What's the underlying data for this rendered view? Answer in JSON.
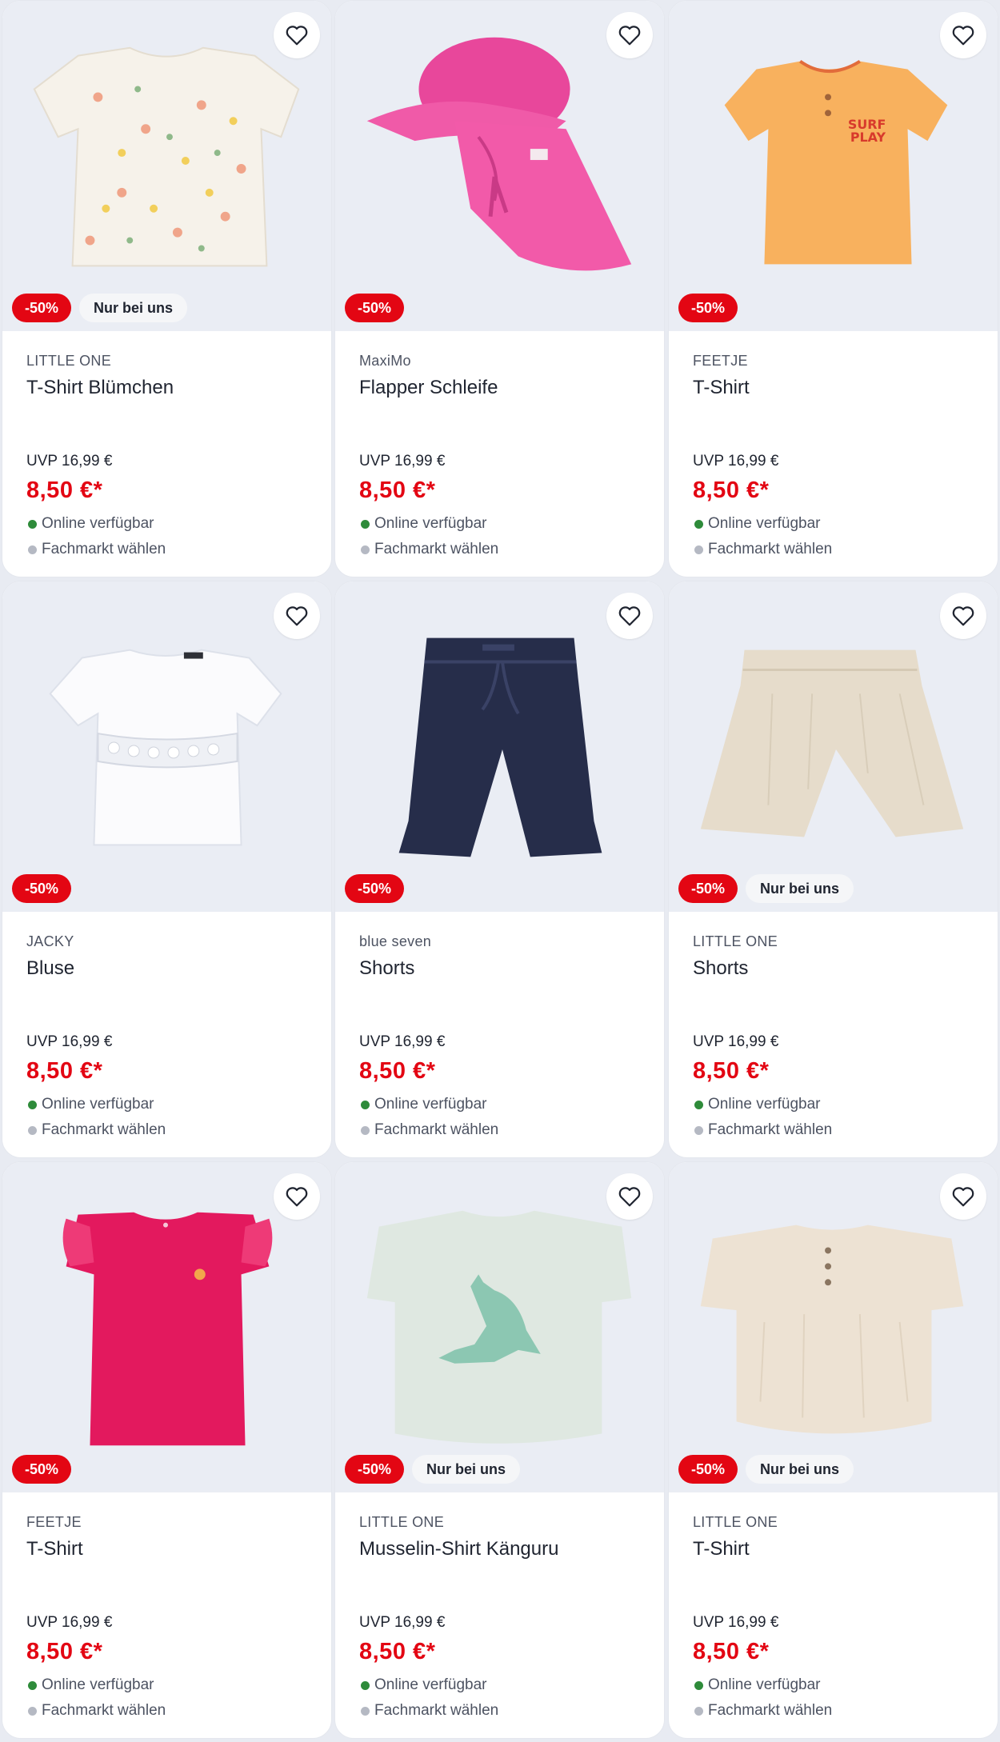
{
  "colors": {
    "sale": "#e30613",
    "available": "#2e8b3a",
    "store_dot": "#b5b9c3"
  },
  "products": [
    {
      "brand": "LITTLE ONE",
      "title": "T-Shirt Blümchen",
      "discount": "-50%",
      "exclusive": "Nur bei uns",
      "uvp": "UVP 16,99 €",
      "price": "8,50 €*",
      "availability": "Online verfügbar",
      "store": "Fachmarkt wählen",
      "image_icon": "floral-blouse"
    },
    {
      "brand": "MaxiMo",
      "title": "Flapper Schleife",
      "discount": "-50%",
      "exclusive": "",
      "uvp": "UVP 16,99 €",
      "price": "8,50 €*",
      "availability": "Online verfügbar",
      "store": "Fachmarkt wählen",
      "image_icon": "pink-sun-hat"
    },
    {
      "brand": "FEETJE",
      "title": "T-Shirt",
      "discount": "-50%",
      "exclusive": "",
      "uvp": "UVP 16,99 €",
      "price": "8,50 €*",
      "availability": "Online verfügbar",
      "store": "Fachmarkt wählen",
      "image_icon": "orange-tshirt"
    },
    {
      "brand": "JACKY",
      "title": "Bluse",
      "discount": "-50%",
      "exclusive": "",
      "uvp": "UVP 16,99 €",
      "price": "8,50 €*",
      "availability": "Online verfügbar",
      "store": "Fachmarkt wählen",
      "image_icon": "white-blouse"
    },
    {
      "brand": "blue seven",
      "title": "Shorts",
      "discount": "-50%",
      "exclusive": "",
      "uvp": "UVP 16,99 €",
      "price": "8,50 €*",
      "availability": "Online verfügbar",
      "store": "Fachmarkt wählen",
      "image_icon": "navy-shorts"
    },
    {
      "brand": "LITTLE ONE",
      "title": "Shorts",
      "discount": "-50%",
      "exclusive": "Nur bei uns",
      "uvp": "UVP 16,99 €",
      "price": "8,50 €*",
      "availability": "Online verfügbar",
      "store": "Fachmarkt wählen",
      "image_icon": "beige-shorts"
    },
    {
      "brand": "FEETJE",
      "title": "T-Shirt",
      "discount": "-50%",
      "exclusive": "",
      "uvp": "UVP 16,99 €",
      "price": "8,50 €*",
      "availability": "Online verfügbar",
      "store": "Fachmarkt wählen",
      "image_icon": "pink-ruffle-tshirt"
    },
    {
      "brand": "LITTLE ONE",
      "title": "Musselin-Shirt Känguru",
      "discount": "-50%",
      "exclusive": "Nur bei uns",
      "uvp": "UVP 16,99 €",
      "price": "8,50 €*",
      "availability": "Online verfügbar",
      "store": "Fachmarkt wählen",
      "image_icon": "kangaroo-shirt"
    },
    {
      "brand": "LITTLE ONE",
      "title": "T-Shirt",
      "discount": "-50%",
      "exclusive": "Nur bei uns",
      "uvp": "UVP 16,99 €",
      "price": "8,50 €*",
      "availability": "Online verfügbar",
      "store": "Fachmarkt wählen",
      "image_icon": "beige-henley-shirt"
    }
  ]
}
